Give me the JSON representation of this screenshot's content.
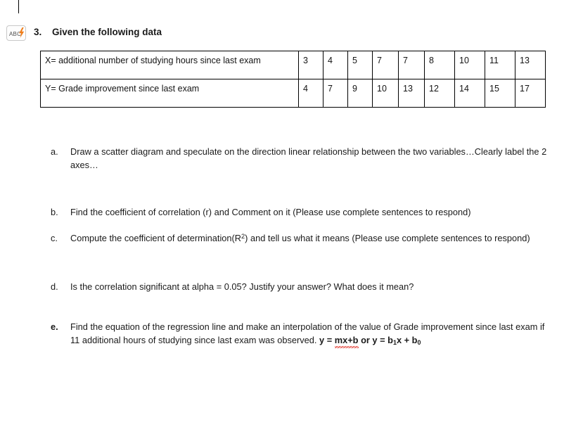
{
  "document": {
    "caret_visible": true,
    "spell_icon": {
      "name": "spell-check-proofing-icon",
      "label": "ABC",
      "bolt_color": "#ef7d1a",
      "border_color": "#c8c8c8"
    },
    "heading": {
      "number": "3.",
      "text": "Given the following data"
    },
    "table": {
      "rows": [
        {
          "label": "X= additional number of studying hours since last exam",
          "values": [
            "3",
            "4",
            "5",
            "7",
            "7",
            "8",
            "10",
            "11",
            "13"
          ]
        },
        {
          "label": "Y= Grade improvement since last exam",
          "values": [
            "4",
            "7",
            "9",
            "10",
            "13",
            "12",
            "14",
            "15",
            "17"
          ]
        }
      ]
    },
    "questions": [
      {
        "marker": "a.",
        "text": "Draw a scatter diagram and speculate on the direction linear relationship between the two variables…Clearly label the 2 axes…"
      },
      {
        "marker": "b.",
        "text": "Find the coefficient of correlation (r) and Comment on it (Please use complete sentences to respond)"
      },
      {
        "marker": "c.",
        "text_before": "Compute the coefficient of determination(R",
        "superscript": "2",
        "text_after": ") and tell us what it means (Please use complete sentences to respond)"
      },
      {
        "marker": "d.",
        "text": "Is the correlation significant at alpha = 0.05? Justify your answer? What does it mean?"
      },
      {
        "marker": "e.",
        "text": "Find the equation of the regression line and make an interpolation of the value of Grade improvement since last exam if 11 additional hours of studying since last exam was observed.",
        "formula": {
          "part1": "y = ",
          "misspelled": "mx+b",
          "part2": " or y = b",
          "sub1": "1",
          "part3": "x + b",
          "sub2": "0"
        }
      }
    ]
  },
  "chart_data": {
    "type": "scatter",
    "title": "X vs Y data table (scatter diagram to be drawn)",
    "xlabel": "X= additional number of studying hours since last exam",
    "ylabel": "Y= Grade improvement since last exam",
    "x": [
      3,
      4,
      5,
      7,
      7,
      8,
      10,
      11,
      13
    ],
    "y": [
      4,
      7,
      9,
      10,
      13,
      12,
      14,
      15,
      17
    ]
  }
}
